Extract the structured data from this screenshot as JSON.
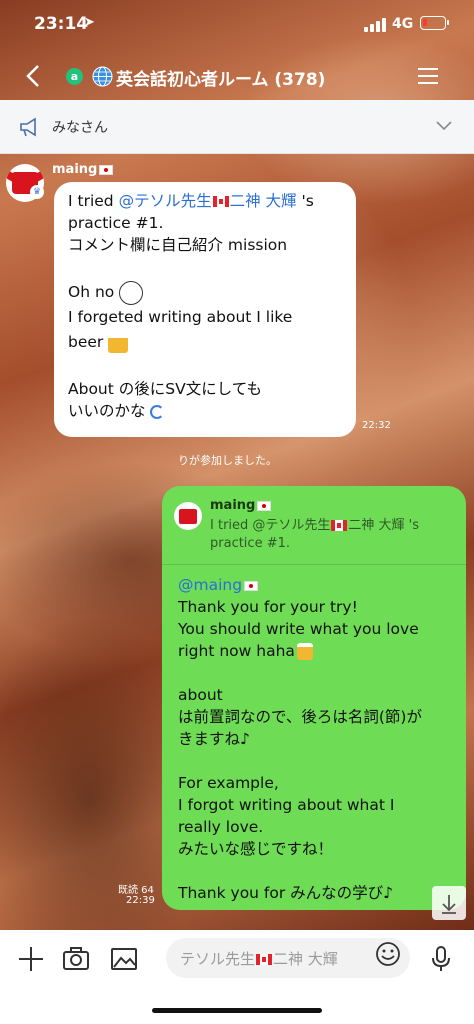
{
  "status": {
    "time": "23:14",
    "network": "4G"
  },
  "header": {
    "title": "英会話初心者ルーム (378)"
  },
  "announcement": {
    "text": "みなさん"
  },
  "incoming": {
    "sender": "maing",
    "line1_prefix": "I tried ",
    "line1_mention": "@テソル先生",
    "line1_mention_name": "二神 大輝",
    "line1_suffix": " 's",
    "line2": "practice #1.",
    "line3": "コメント欄に自己紹介 mission",
    "line4": "Oh no ",
    "line5": "I forgeted writing about I like",
    "line6": "beer",
    "line7": "About の後にSV文にしても",
    "line8": "いいのかな",
    "time": "22:32"
  },
  "system_message": "りが参加しました。",
  "outgoing": {
    "reply_name": "maing",
    "reply_quote_prefix": "I tried @テソル先生",
    "reply_quote_name": "二神 大輝 's",
    "reply_quote_line2": "practice #1.",
    "mention": "@maing",
    "lines": [
      "Thank you for your try!",
      "You should write what you love",
      "right now haha",
      "",
      "about",
      "は前置詞なので、後ろは名詞(節)が",
      "きますね♪",
      "",
      "For example,",
      "I forgot writing about what I",
      "really love.",
      "みたいな感じですね！",
      "",
      "Thank you for みんなの学び♪"
    ],
    "read_count": "既読 64",
    "time": "22:39"
  },
  "input": {
    "placeholder_prefix": "テソル先生",
    "placeholder_suffix": "二神 大輝"
  }
}
